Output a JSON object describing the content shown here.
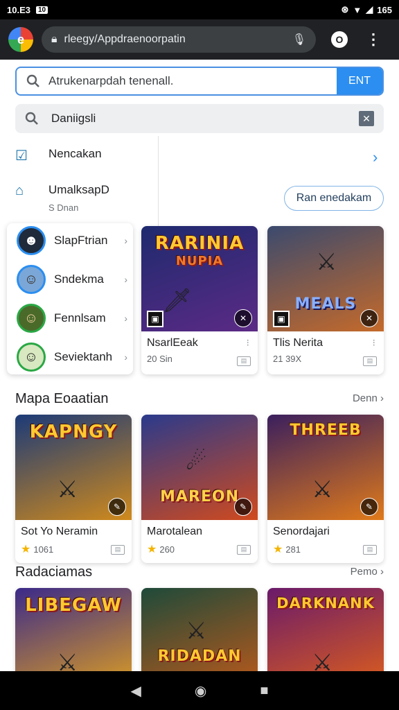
{
  "status_bar": {
    "time": "10.E3",
    "badge": "10",
    "battery": "165"
  },
  "toolbar": {
    "logo_letter": "e",
    "url": "rleegy/Appdraenoorpatin",
    "tab_count": "O"
  },
  "search": {
    "placeholder": "Atrukenarpdah tenenall.",
    "go_label": "ENT",
    "secondary_label": "Daniigsli"
  },
  "menu": {
    "item1_label": "Nencakan",
    "item2_label": "UmalksapD",
    "item2_sub": "S Dnan",
    "pill_label": "Ran enedakam"
  },
  "contacts": [
    {
      "name": "SlapFtrian"
    },
    {
      "name": "Sndekma"
    },
    {
      "name": "Fennlsam"
    },
    {
      "name": "Seviektanh"
    }
  ],
  "top_games": [
    {
      "art_title": "RARINIA",
      "art_sub": "NUPIA",
      "title": "NsarlEeak",
      "stat": "20 Sin",
      "colors": [
        "#1e2a6e",
        "#5b2a85"
      ]
    },
    {
      "art_title": "MEALS",
      "art_sub": "",
      "title": "Tlis Nerita",
      "stat": "21 39X",
      "colors": [
        "#3b4a6e",
        "#c56a2a"
      ]
    }
  ],
  "section1": {
    "title": "Mapa Eoaatian",
    "more": "Denn",
    "games": [
      {
        "art_title": "KAPNGY",
        "title": "Sot Yo Neramin",
        "rating": "1061",
        "colors": [
          "#1b3a78",
          "#d08a1c"
        ]
      },
      {
        "art_title": "MAREON",
        "title": "Marotalean",
        "rating": "260",
        "colors": [
          "#2a3a8c",
          "#d04a1e"
        ]
      },
      {
        "art_title": "THREEB",
        "title": "Senordajari",
        "rating": "281",
        "colors": [
          "#3a1f5e",
          "#e07a1a"
        ]
      }
    ]
  },
  "section2": {
    "title": "Radaciamas",
    "more": "Pemo",
    "games": [
      {
        "art_title": "LIBEGAW",
        "colors": [
          "#3b2a8a",
          "#e0a020"
        ]
      },
      {
        "art_title": "RIDADAN",
        "colors": [
          "#1e4a3a",
          "#c05a1a"
        ]
      },
      {
        "art_title": "DARKNANK",
        "colors": [
          "#6a1a6a",
          "#e0601a"
        ]
      }
    ]
  }
}
